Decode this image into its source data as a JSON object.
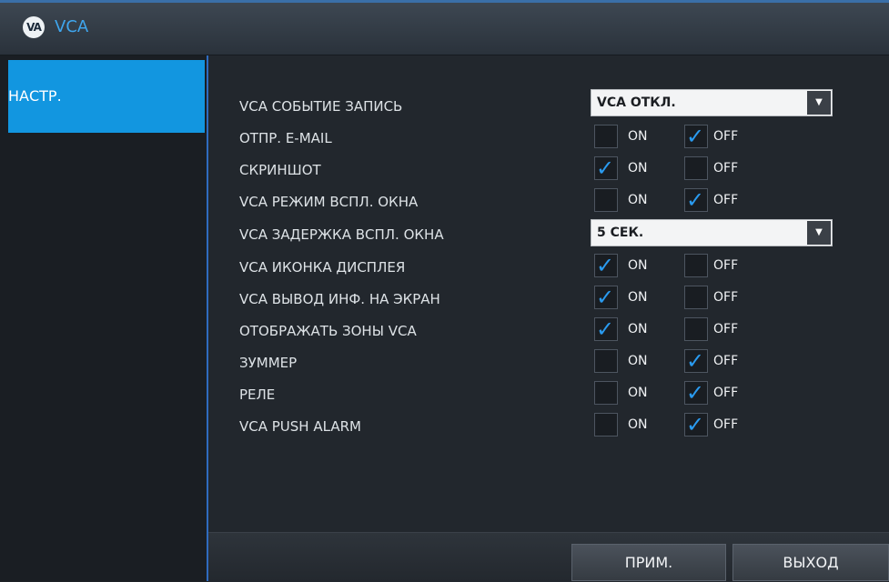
{
  "window": {
    "title": "VCA",
    "logo_text": "VA",
    "logo_icon": "vca-logo-icon"
  },
  "sidebar": {
    "items": [
      {
        "label": "НАСТР.",
        "active": true
      }
    ]
  },
  "colors": {
    "accent": "#1296e0",
    "title_text": "#3fa6ee",
    "check": "#2a9bf0"
  },
  "settings": {
    "record_event": {
      "label": "VCA СОБЫТИЕ ЗАПИСЬ",
      "value": "VCA ОТКЛ."
    },
    "email": {
      "label": "ОТПР. E-MAIL",
      "on_label": "ON",
      "off_label": "OFF",
      "on": false,
      "off": true
    },
    "screenshot": {
      "label": "СКРИНШОТ",
      "on_label": "ON",
      "off_label": "OFF",
      "on": true,
      "off": false
    },
    "popup_mode": {
      "label": "VCA РЕЖИМ ВСПЛ. ОКНА",
      "on_label": "ON",
      "off_label": "OFF",
      "on": false,
      "off": true
    },
    "popup_delay": {
      "label": "VCA ЗАДЕРЖКА ВСПЛ. ОКНА",
      "value": "5 СЕК."
    },
    "display_icon": {
      "label": "VCA ИКОНКА ДИСПЛЕЯ",
      "on_label": "ON",
      "off_label": "OFF",
      "on": true,
      "off": false
    },
    "info_output": {
      "label": "VCA ВЫВОД ИНФ. НА ЭКРАН",
      "on_label": "ON",
      "off_label": "OFF",
      "on": true,
      "off": false
    },
    "show_zones": {
      "label": "ОТОБРАЖАТЬ ЗОНЫ VCA",
      "on_label": "ON",
      "off_label": "OFF",
      "on": true,
      "off": false
    },
    "buzzer": {
      "label": "ЗУММЕР",
      "on_label": "ON",
      "off_label": "OFF",
      "on": false,
      "off": true
    },
    "relay": {
      "label": "РЕЛЕ",
      "on_label": "ON",
      "off_label": "OFF",
      "on": false,
      "off": true
    },
    "push_alarm": {
      "label": "VCA PUSH ALARM",
      "on_label": "ON",
      "off_label": "OFF",
      "on": false,
      "off": true
    }
  },
  "footer": {
    "apply_label": "ПРИМ.",
    "exit_label": "ВЫХОД"
  }
}
